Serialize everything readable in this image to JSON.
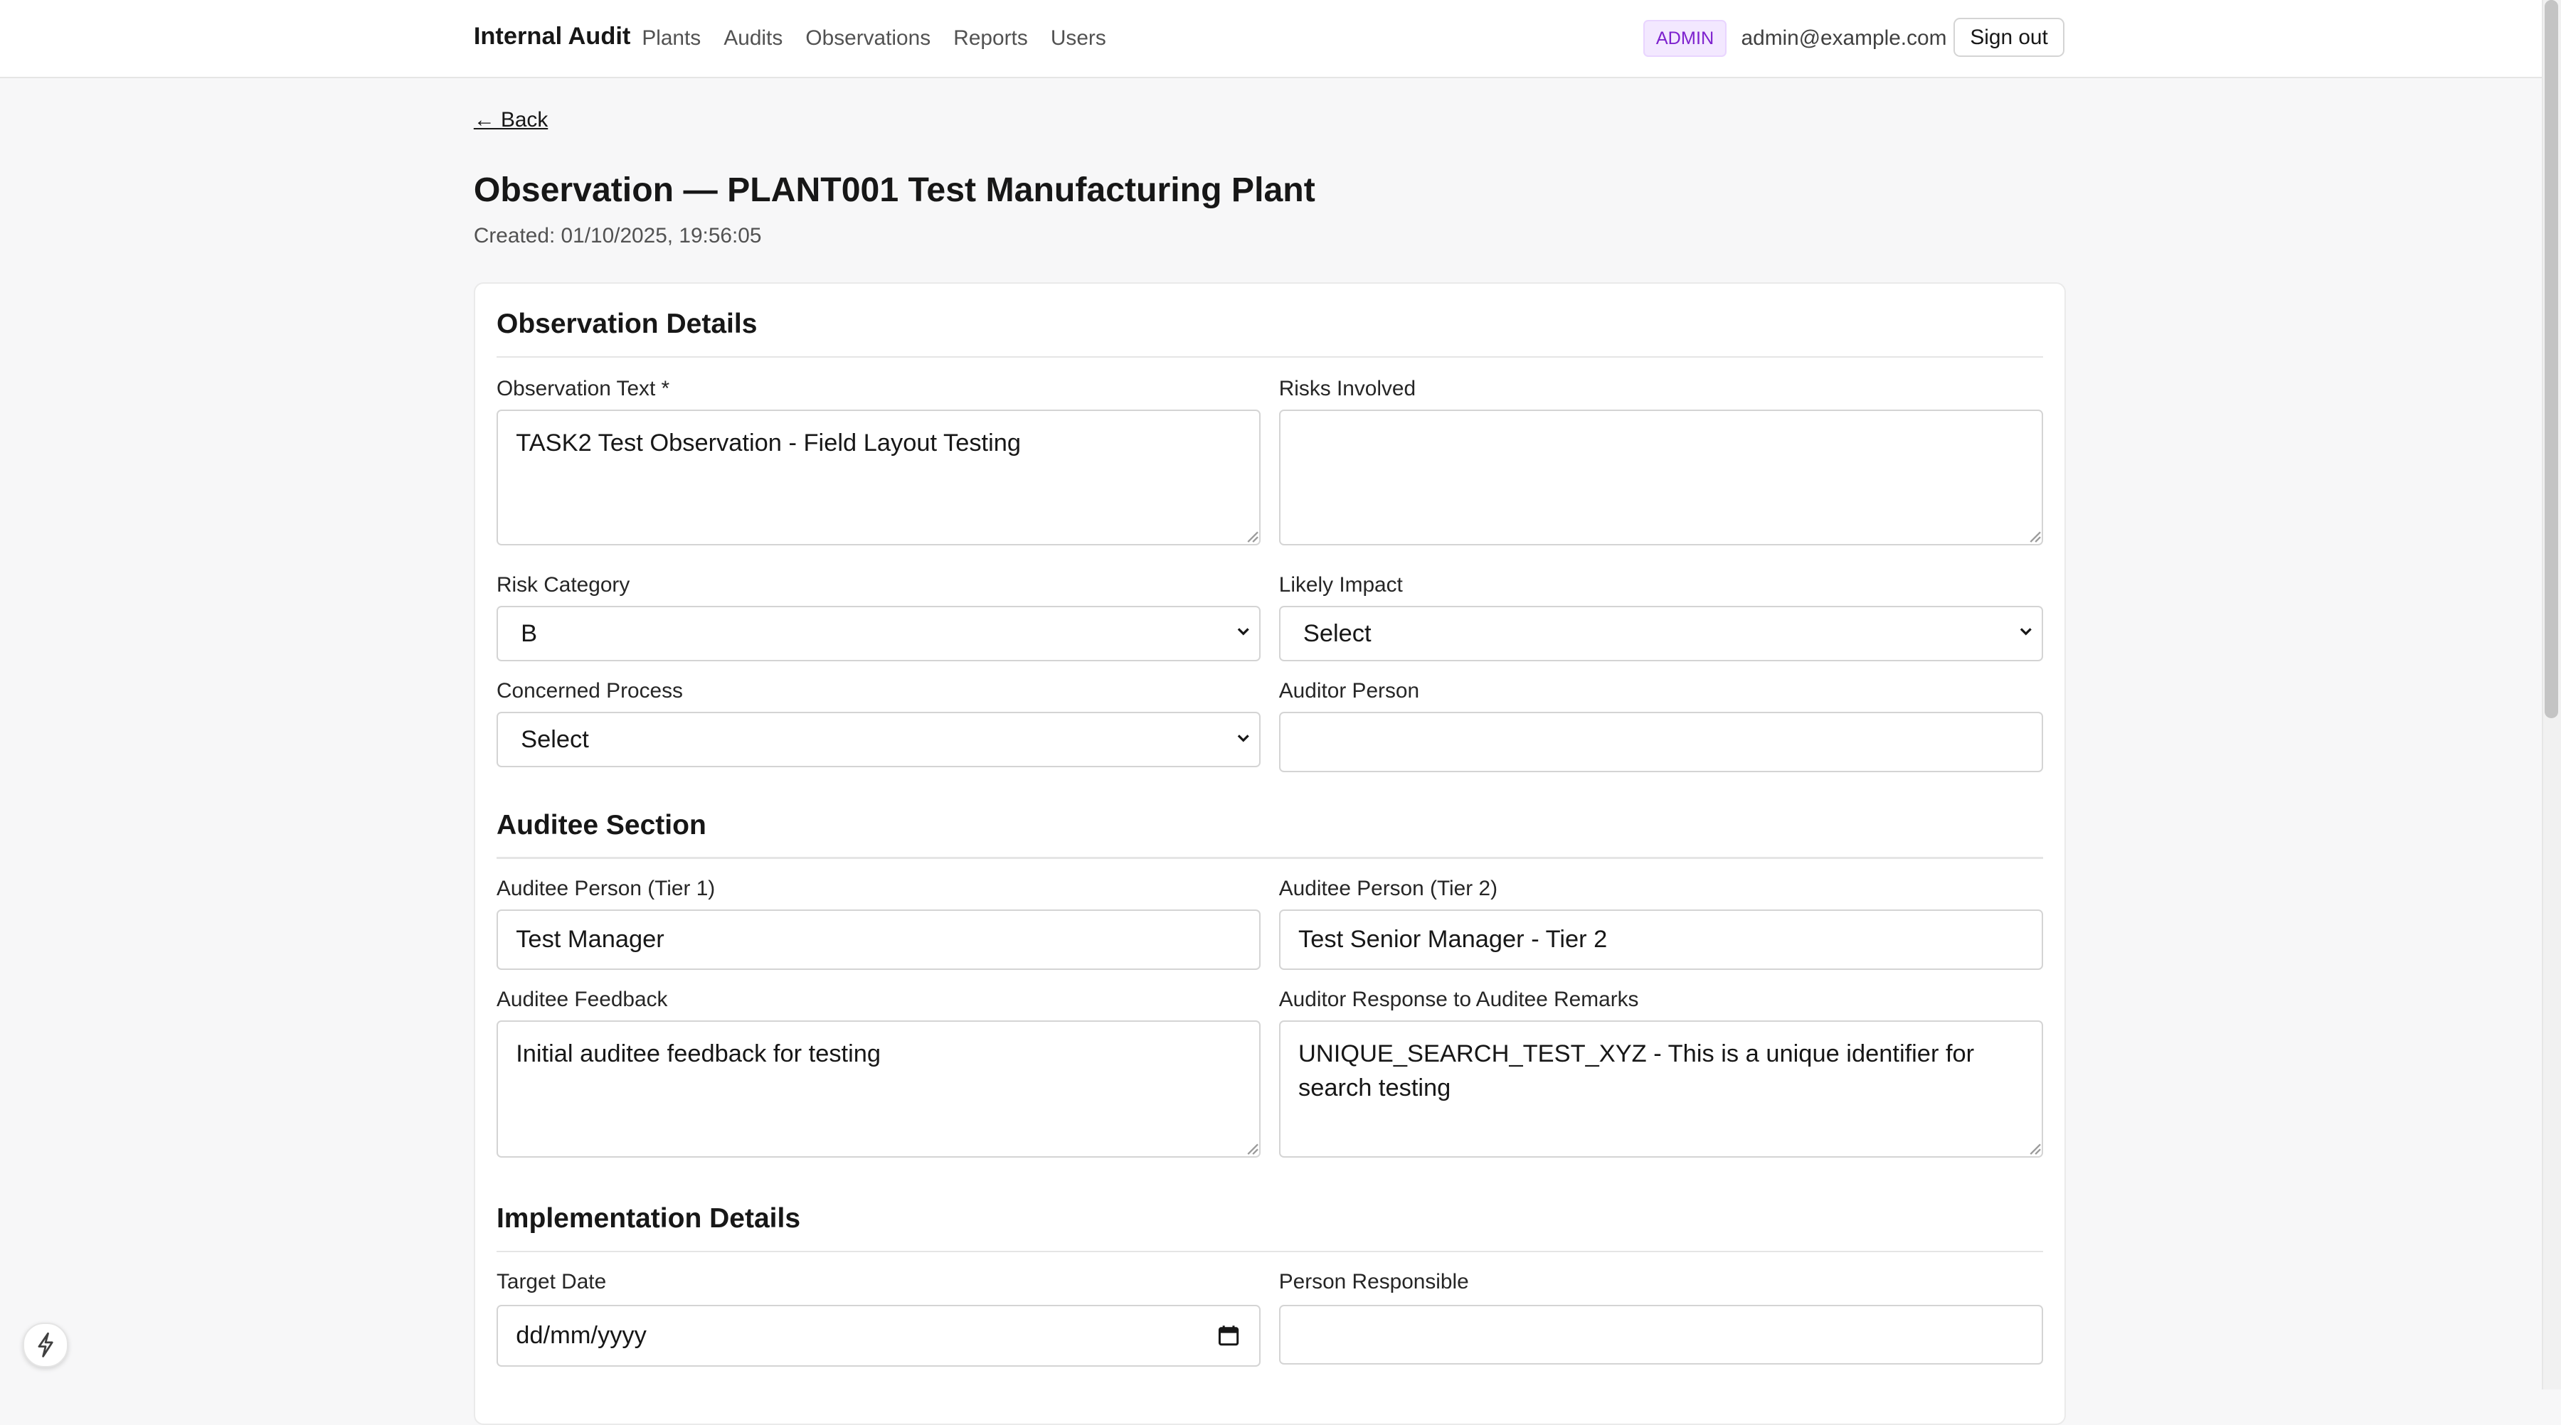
{
  "app": {
    "title": "Internal Audit"
  },
  "nav": {
    "items": [
      "Plants",
      "Audits",
      "Observations",
      "Reports",
      "Users"
    ]
  },
  "user": {
    "role": "ADMIN",
    "email": "admin@example.com",
    "signout_label": "Sign out"
  },
  "page": {
    "back_label": "← Back",
    "title": "Observation — PLANT001 Test Manufacturing Plant",
    "created": "Created: 01/10/2025, 19:56:05"
  },
  "sections": {
    "details": {
      "title": "Observation Details",
      "observation_text_label": "Observation Text *",
      "observation_text_value": "TASK2 Test Observation - Field Layout Testing",
      "risks_label": "Risks Involved",
      "risks_value": "",
      "risk_category_label": "Risk Category",
      "risk_category_value": "B",
      "likely_impact_label": "Likely Impact",
      "likely_impact_value": "Select",
      "concerned_process_label": "Concerned Process",
      "concerned_process_value": "Select",
      "auditor_person_label": "Auditor Person",
      "auditor_person_value": ""
    },
    "auditee": {
      "title": "Auditee Section",
      "tier1_label": "Auditee Person (Tier 1)",
      "tier1_value": "Test Manager",
      "tier2_label": "Auditee Person (Tier 2)",
      "tier2_value": "Test Senior Manager - Tier 2",
      "feedback_label": "Auditee Feedback",
      "feedback_value": "Initial auditee feedback for testing",
      "response_label": "Auditor Response to Auditee Remarks",
      "response_value": "UNIQUE_SEARCH_TEST_XYZ - This is a unique identifier for search testing"
    },
    "implementation": {
      "title": "Implementation Details",
      "target_date_label": "Target Date",
      "target_date_placeholder": "dd/mm/yyyy",
      "person_responsible_label": "Person Responsible",
      "person_responsible_value": ""
    }
  },
  "icons": {
    "chevron": "chevron-down-icon",
    "calendar": "calendar-icon",
    "fab": "lightning-icon"
  },
  "colors": {
    "admin_badge_bg": "#f3e8ff",
    "admin_badge_text": "#7e22ce",
    "page_bg": "#f7f7f8"
  }
}
